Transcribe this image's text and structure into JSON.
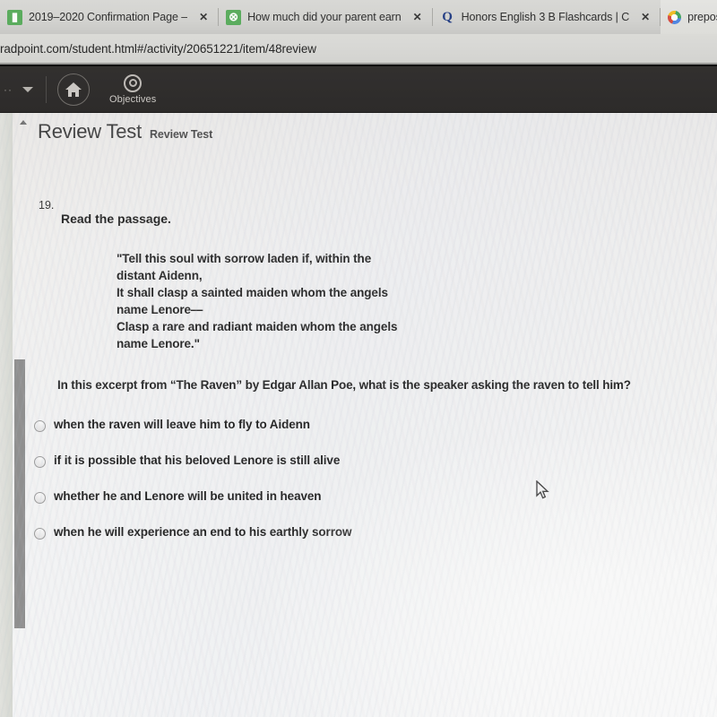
{
  "browser": {
    "tabs": [
      {
        "title": "2019–2020 Confirmation Page –",
        "favicon": "green-doc-icon",
        "close": "✕",
        "active": false
      },
      {
        "title": "How much did your parent earn",
        "favicon": "quizlet-icon",
        "close": "✕",
        "active": false
      },
      {
        "title": "Honors English 3 B Flashcards | C",
        "favicon": "quizlet-q-icon",
        "close": "✕",
        "active": false
      },
      {
        "title": "prepositional",
        "favicon": "google-icon",
        "close": "",
        "active": true
      }
    ],
    "url": "radpoint.com/student.html#/activity/20651221/item/48review"
  },
  "appbar": {
    "overflow_dots": "··",
    "home_label": "home-icon",
    "objectives_label": "Objectives"
  },
  "page": {
    "title": "Review Test",
    "subtitle": "Review Test",
    "question_number": "19.",
    "prompt": "Read the passage.",
    "passage": "\"Tell this soul with sorrow laden if, within the\ndistant Aidenn,\nIt shall clasp a sainted maiden whom the angels\nname Lenore—\nClasp a rare and radiant maiden whom the angels\nname Lenore.\"",
    "question": "In this excerpt from “The Raven” by Edgar Allan Poe, what is the speaker asking the raven to tell him?",
    "options": [
      {
        "label": "when the raven will leave him to fly to Aidenn",
        "selected": false
      },
      {
        "label": "if it is possible that his beloved Lenore is still alive",
        "selected": false
      },
      {
        "label": "whether he and Lenore will be united in heaven",
        "selected": false
      },
      {
        "label": "when he will experience an end to his earthly sorrow",
        "selected": false
      }
    ]
  },
  "colors": {
    "appbar_bg": "#2c2a28",
    "tabstrip_bg": "#d7d7d3",
    "page_bg": "#f3f2f0",
    "text": "#1f1f1f",
    "scrollbar": "#8d8d8d"
  }
}
